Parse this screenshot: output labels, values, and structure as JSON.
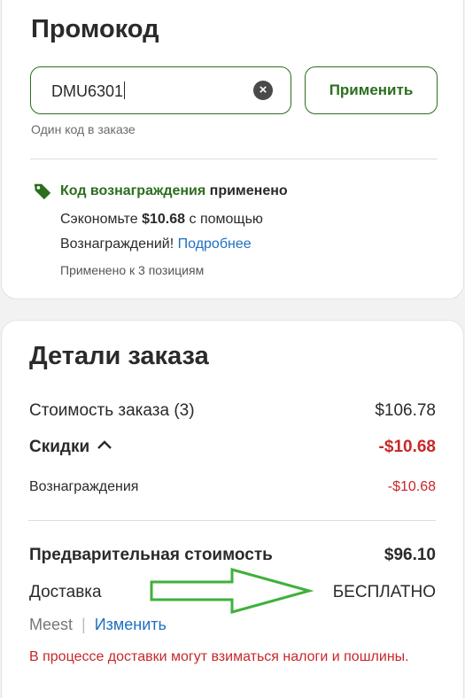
{
  "promo": {
    "title": "Промокод",
    "input_value": "DMU6301",
    "apply_label": "Применить",
    "hint": "Один код в заказе",
    "reward_highlight": "Код вознаграждения",
    "reward_status": " применено",
    "save_prefix": "Сэкономьте ",
    "save_amount": "$10.68",
    "save_suffix": " с помощью",
    "rewards_text": "Вознаграждений! ",
    "more_link": "Подробнее",
    "applied_note": "Применено к 3 позициям",
    "accent_color": "#2b6e1e"
  },
  "order": {
    "title": "Детали заказа",
    "subtotal_label": "Стоимость заказа (3)",
    "subtotal_value": "$106.78",
    "discounts_label": "Скидки",
    "discounts_value": "-$10.68",
    "rewards_label": "Вознаграждения",
    "rewards_value": "-$10.68",
    "estimated_label": "Предварительная стоимость",
    "estimated_value": "$96.10",
    "shipping_label": "Доставка",
    "shipping_value": "БЕСПЛАТНО",
    "carrier": "Meest",
    "separator": "|",
    "change_link": "Изменить",
    "tax_warning": "В процессе доставки могут взиматься налоги и пошлины.",
    "discount_color": "#c8282a"
  },
  "annotation": {
    "arrow_color": "#3fb13b",
    "arrow_icon": "arrow-right-outline"
  }
}
